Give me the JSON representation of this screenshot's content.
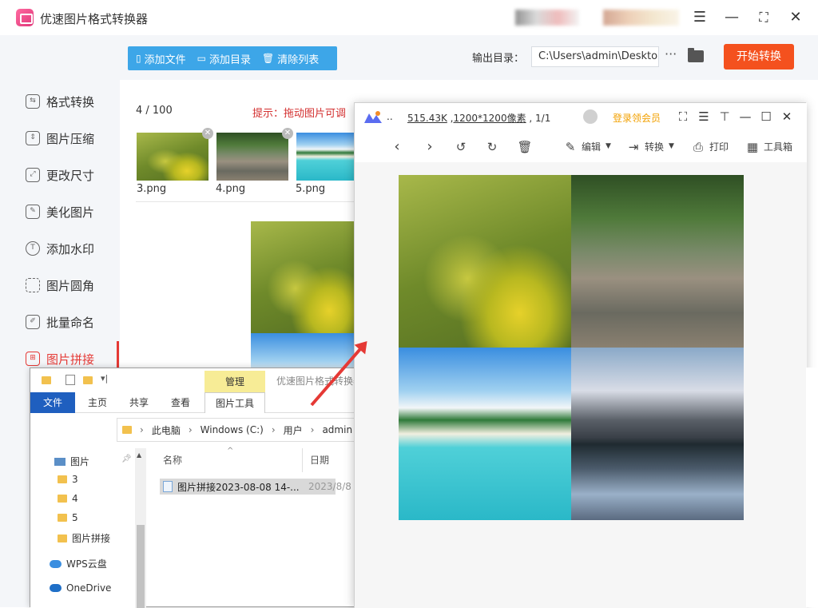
{
  "app": {
    "title": "优速图片格式转换器"
  },
  "toolbar": {
    "add_file": "添加文件",
    "add_dir": "添加目录",
    "clear_list": "清除列表",
    "output_label": "输出目录：",
    "output_path": "C:\\Users\\admin\\Deskto",
    "start": "开始转换"
  },
  "sidebar": {
    "items": [
      {
        "label": "格式转换",
        "icon": "format-convert-icon"
      },
      {
        "label": "图片压缩",
        "icon": "compress-icon"
      },
      {
        "label": "更改尺寸",
        "icon": "resize-icon"
      },
      {
        "label": "美化图片",
        "icon": "beautify-icon"
      },
      {
        "label": "添加水印",
        "icon": "watermark-icon"
      },
      {
        "label": "图片圆角",
        "icon": "round-corner-icon"
      },
      {
        "label": "批量命名",
        "icon": "rename-icon"
      },
      {
        "label": "图片拼接",
        "icon": "stitch-icon",
        "active": true
      }
    ]
  },
  "content": {
    "count": "4 / 100",
    "hint": "提示：拖动图片可调",
    "files": [
      "3.png",
      "4.png",
      "5.png"
    ]
  },
  "explorer": {
    "manage": "管理",
    "title": "优速图片格式转换器",
    "tabs": [
      "文件",
      "主页",
      "共享",
      "查看",
      "图片工具"
    ],
    "path": [
      "此电脑",
      "Windows (C:)",
      "用户",
      "admin"
    ],
    "tree": [
      "图片",
      "3",
      "4",
      "5",
      "图片拼接",
      "WPS云盘",
      "OneDrive"
    ],
    "col_name": "名称",
    "col_date": "日期",
    "file_name": "图片拼接2023-08-08 14-...",
    "file_date": "2023/8/8"
  },
  "viewer": {
    "dots": "..",
    "size": "515.43K",
    "dims": "1200*1200像素",
    "page": "1/1",
    "vip": "登录领会员",
    "edit": "编辑",
    "convert": "转换",
    "print": "打印",
    "tools": "工具箱"
  },
  "colors": {
    "accent_blue": "#3da6e8",
    "start_orange": "#f4511e",
    "active_red": "#e53935",
    "vip_gold": "#f2a000"
  }
}
